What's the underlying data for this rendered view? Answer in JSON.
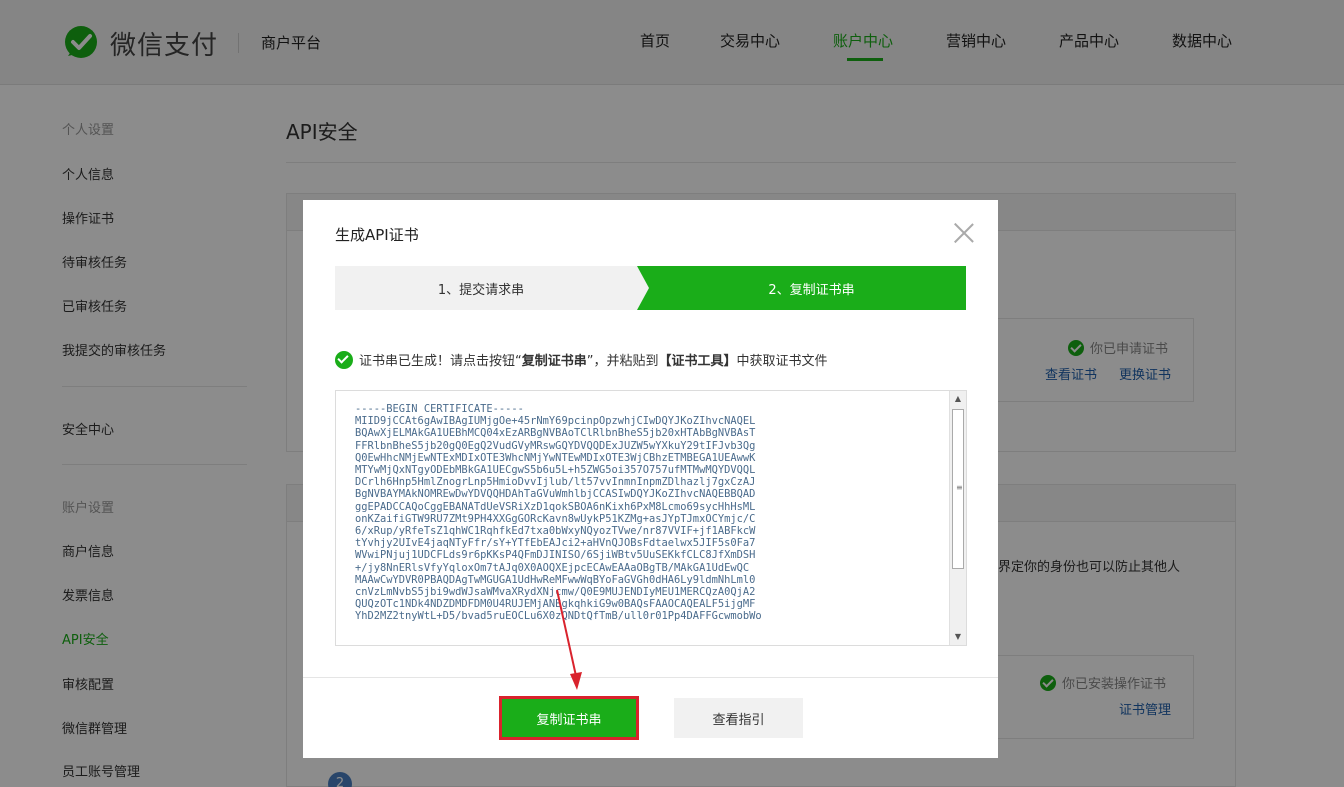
{
  "header": {
    "brand": "微信支付",
    "platform": "商户平台",
    "nav": [
      "首页",
      "交易中心",
      "账户中心",
      "营销中心",
      "产品中心",
      "数据中心"
    ],
    "active_nav": "账户中心"
  },
  "sidebar": {
    "group1": "个人设置",
    "items1": [
      "个人信息",
      "操作证书",
      "待审核任务",
      "已审核任务",
      "我提交的审核任务"
    ],
    "security": "安全中心",
    "group2": "账户设置",
    "items2": [
      "商户信息",
      "发票信息",
      "API安全",
      "审核配置",
      "微信群管理",
      "员工账号管理"
    ]
  },
  "main": {
    "title": "API安全",
    "cert_status": "你已申请证书",
    "view_cert": "查看证书",
    "change_cert": "更换证书",
    "desc_tail": "界定你的身份也可以防止其他人",
    "op_cert_status": "你已安装操作证书",
    "cert_manage": "证书管理",
    "step_badge": "2"
  },
  "modal": {
    "title": "生成API证书",
    "step1": "1、提交请求串",
    "step2": "2、复制证书串",
    "notice_pre": "证书串已生成！请点击按钮“",
    "notice_btn": "复制证书串",
    "notice_mid": "”，并粘贴到",
    "notice_tool": "【证书工具】",
    "notice_post": "中获取证书文件",
    "cert_text": "-----BEGIN CERTIFICATE-----\nMIID9jCCAt6gAwIBAgIUMjgOe+45rNmY69pcinpOpzwhjCIwDQYJKoZIhvcNAQEL\nBQAwXjELMAkGA1UEBhMCQ04xEzARBgNVBAoTClRlbnBheS5jb20xHTAbBgNVBAsT\nFFRlbnBheS5jb20gQ0EgQ2VudGVyMRswGQYDVQQDExJUZW5wYXkuY29tIFJvb3Qg\nQ0EwHhcNMjEwNTExMDIxOTE3WhcNMjYwNTEwMDIxOTE3WjCBhzETMBEGA1UEAwwK\nMTYwMjQxNTgyODEbMBkGA1UECgwS5b6u5L+h5ZWG5oi357O757ufMTMwMQYDVQQL\nDCrlh6Hnp5HmlZnogrLnp5HmioDvvIjlub/lt57vvInmnInpmZDlhazlj7gxCzAJ\nBgNVBAYMAkNOMREwDwYDVQQHDAhTaGVuWmhlbjCCASIwDQYJKoZIhvcNAQEBBQAD\nggEPADCCAQoCggEBANATdUeVSRiXzD1qokSBOA6nKixh6PxM8Lcmo69sycHhHsML\nonKZaifiGTW9RU7ZMt9PH4XXGgGORcKavn8wUykP51KZMg+asJYpTJmxOCYmjc/C\n6/xRup/yRfeTsZ1qhWC1RqhfkEd7txa0bWxyNQyozTVwe/nr87VVIF+jf1ABFkcW\ntYvhjy2UIvE4jaqNTyFfr/sY+YTfEbEAJci2+aHVnQJOBsFdtaelwx5JIF5s0Fa7\nWVwiPNjuj1UDCFLds9r6pKKsP4QFmDJINISO/6SjiWBtv5UuSEKkfCLC8JfXmDSH\n+/jy8NnERlsVfyYqloxOm7tAJq0X0AOQXEjpcECAwEAAaOBgTB/MAkGA1UdEwQC\nMAAwCwYDVR0PBAQDAgTwMGUGA1UdHwReMFwwWqBYoFaGVGh0dHA6Ly9ldmNhLml0\ncnVzLmNvbS5jbi9wdWJsaWMvaXRydXNjcmw/Q0E9MUJENDIyMEU1MERCQzA0QjA2\nQUQzOTc1NDk4NDZDMDFDM0U4RUJEMjANBgkqhkiG9w0BAQsFAAOCAQEALF5ijgMF\nYhD2MZ2tnyWtL+D5/bvad5ruEOCLu6X0zQNDtQfTmB/ull0r01Pp4DAFFGcwmobWo"
  },
  "buttons": {
    "copy": "复制证书串",
    "guide": "查看指引"
  },
  "colors": {
    "brand_green": "#1aad19",
    "link_blue": "#1f5fab",
    "highlight_red": "#d9232d"
  }
}
